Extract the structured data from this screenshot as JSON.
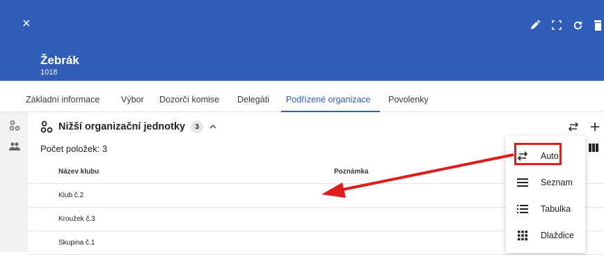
{
  "header": {
    "close_icon": "×",
    "title": "Žebrák",
    "subtitle": "1018",
    "background": "#2f5db8"
  },
  "tabs": [
    {
      "label": "Základní informace"
    },
    {
      "label": "Výbor"
    },
    {
      "label": "Dozorčí komise"
    },
    {
      "label": "Delegáti"
    },
    {
      "label": "Podřízené organizace",
      "active": true
    },
    {
      "label": "Povolenky"
    }
  ],
  "section": {
    "title": "Nižší organizační jednotky",
    "badge": "3",
    "count_label": "Počet položek: 3"
  },
  "table": {
    "columns": [
      "Název klubu",
      "Poznámka"
    ],
    "rows": [
      {
        "name": "Klub č.2",
        "note": ""
      },
      {
        "name": "Kroužek č.3",
        "note": ""
      },
      {
        "name": "Skupina č.1",
        "note": ""
      }
    ]
  },
  "view_menu": {
    "items": [
      {
        "label": "Auto",
        "icon": "swap-icon",
        "highlighted": true
      },
      {
        "label": "Seznam",
        "icon": "list-icon"
      },
      {
        "label": "Tabulka",
        "icon": "table-list-icon"
      },
      {
        "label": "Dlaždice",
        "icon": "tiles-icon"
      }
    ]
  },
  "annotation": {
    "color": "#e21b1b"
  }
}
